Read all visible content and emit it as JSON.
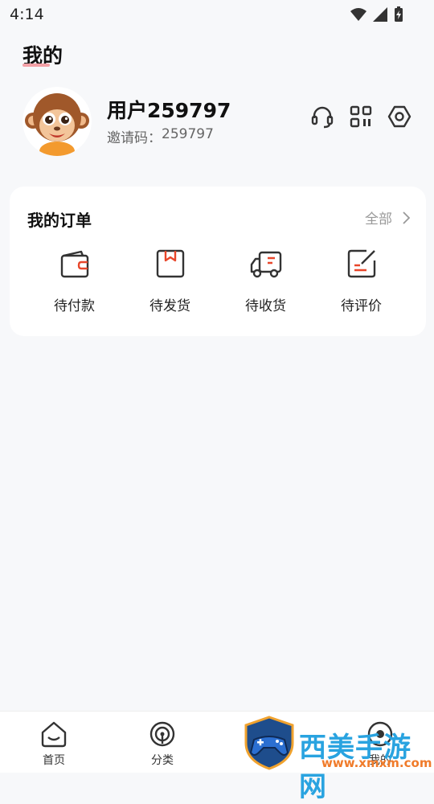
{
  "status_bar": {
    "time": "4:14"
  },
  "header": {
    "title": "我的"
  },
  "profile": {
    "username": "用户259797",
    "invite_label": "邀请码：",
    "invite_code": "259797",
    "actions": [
      "headset-icon",
      "qrcode-icon",
      "settings-icon"
    ]
  },
  "orders": {
    "title": "我的订单",
    "all_label": "全部",
    "items": [
      {
        "label": "待付款",
        "icon": "wallet-icon"
      },
      {
        "label": "待发货",
        "icon": "package-icon"
      },
      {
        "label": "待收货",
        "icon": "truck-icon"
      },
      {
        "label": "待评价",
        "icon": "review-icon"
      }
    ]
  },
  "bottom_nav": {
    "items": [
      {
        "label": "首页",
        "icon": "home-icon"
      },
      {
        "label": "分类",
        "icon": "category-icon"
      },
      {
        "label": "我的",
        "icon": "profile-icon"
      }
    ]
  },
  "watermark": {
    "text": "西美手游网",
    "url": "www.xmxm.com"
  },
  "colors": {
    "accent": "#e8462a",
    "background": "#f7f8fa"
  }
}
